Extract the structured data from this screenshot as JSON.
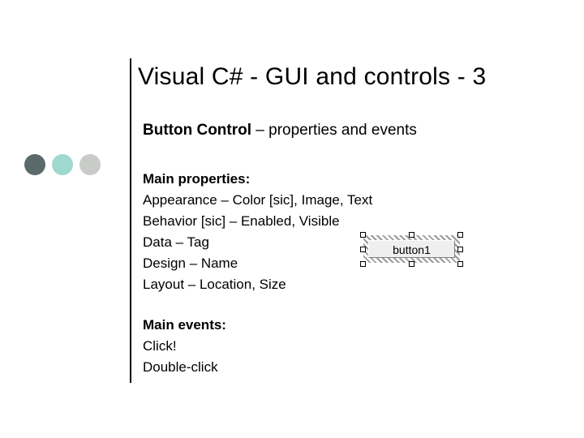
{
  "title": "Visual C# - GUI and controls - 3",
  "subtitle": {
    "bold": "Button Control",
    "rest": " – properties and events"
  },
  "props": {
    "header": "Main properties:",
    "lines": [
      "Appearance – Color [sic], Image, Text",
      "Behavior [sic] – Enabled, Visible",
      "Data – Tag",
      "Design – Name",
      "Layout – Location, Size"
    ]
  },
  "events": {
    "header": "Main events:",
    "lines": [
      "Click!",
      "Double-click"
    ]
  },
  "button_demo": {
    "label": "button1"
  }
}
